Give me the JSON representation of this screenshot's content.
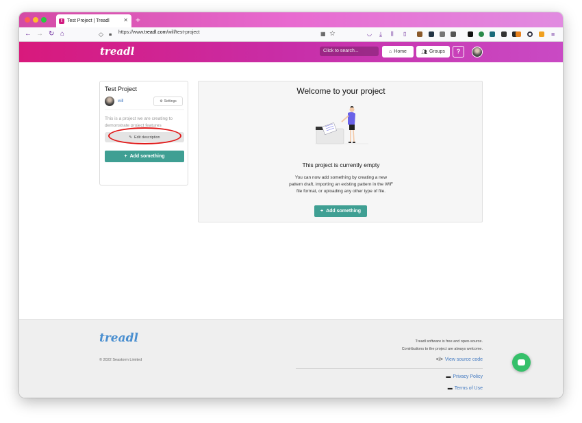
{
  "browser": {
    "tab_title": "Test Project | Treadl",
    "url_prefix": "https://www.",
    "url_host": "treadl.com",
    "url_path": "/will/test-project"
  },
  "header": {
    "logo": "treadl",
    "search_placeholder": "Click to search...",
    "home_label": "Home",
    "groups_label": "Groups",
    "help_label": "?"
  },
  "project_card": {
    "title": "Test Project",
    "owner": "will",
    "settings_label": "Settings",
    "description": "This is a project we are creating to demonstrate project features",
    "edit_description_label": "Edit description",
    "add_label": "Add something"
  },
  "welcome": {
    "title": "Welcome to your project",
    "empty_title": "This project is currently empty",
    "empty_text": "You can now add something by creating a new pattern draft, importing an existing pattern in the WIF file format, or uploading any other type of file.",
    "add_label": "Add something"
  },
  "footer": {
    "logo": "treadl",
    "copyright": "© 2022 Seastorm Limited",
    "free_line": "Treadl software is free and open-source.",
    "contrib_line": "Contributions to the project are always welcome.",
    "source_label": "View source code",
    "privacy_label": "Privacy Policy",
    "terms_label": "Terms of Use"
  },
  "colors": {
    "brand_pink": "#d8197c",
    "teal": "#3f9f93",
    "annotation_red": "#e01818",
    "chat_green": "#35c06a"
  }
}
